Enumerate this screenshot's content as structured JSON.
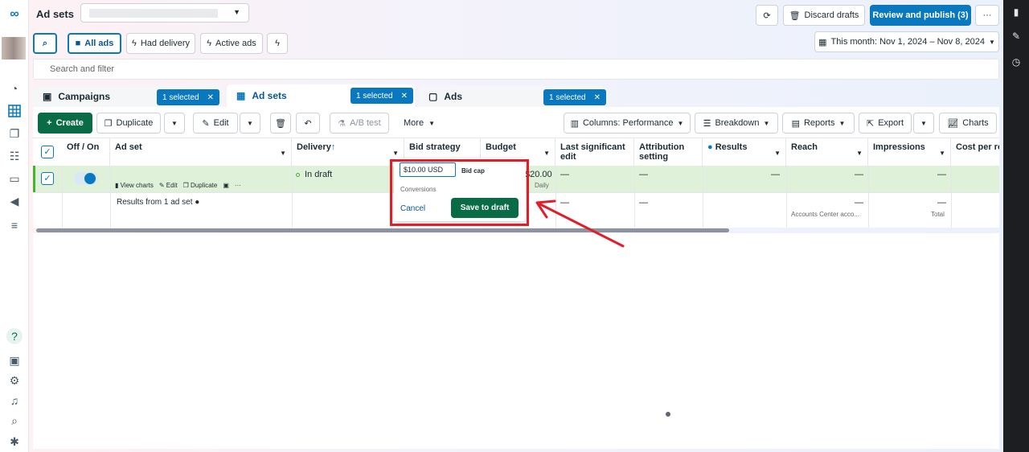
{
  "sidebar_left": {
    "icons": [
      "meta-logo-icon",
      "account-avatar-icon",
      "dashboard-icon",
      "table-icon",
      "pages-icon",
      "audiences-icon",
      "billing-icon",
      "megaphone-icon",
      "menu-icon",
      "help-icon",
      "events-icon",
      "settings-icon",
      "bell-icon",
      "search-icon",
      "bug-icon"
    ]
  },
  "header": {
    "title": "Ad sets",
    "refresh_label": "",
    "discard_label": "Discard drafts",
    "review_label": "Review and publish (3)",
    "more_label": "···"
  },
  "filters": {
    "all_ads": "All ads",
    "had_delivery": "Had delivery",
    "active_ads": "Active ads",
    "date_range": "This month: Nov 1, 2024 – Nov 8, 2024",
    "search_placeholder": "Search and filter"
  },
  "tabs": [
    {
      "label": "Campaigns",
      "chip": "1 selected"
    },
    {
      "label": "Ad sets",
      "chip": "1 selected"
    },
    {
      "label": "Ads",
      "chip": "1 selected"
    }
  ],
  "toolbar": {
    "create": "Create",
    "duplicate": "Duplicate",
    "edit": "Edit",
    "ab_test": "A/B test",
    "more": "More",
    "columns": "Columns: Performance",
    "breakdown": "Breakdown",
    "reports": "Reports",
    "export": "Export",
    "charts": "Charts"
  },
  "table": {
    "headers": {
      "offon": "Off / On",
      "adset": "Ad set",
      "delivery": "Delivery",
      "bid_strategy": "Bid strategy",
      "budget": "Budget",
      "last_edit": "Last significant edit",
      "attribution": "Attribution setting",
      "results": "Results",
      "reach": "Reach",
      "impressions": "Impressions",
      "cost": "Cost per res"
    },
    "row": {
      "delivery": "In draft",
      "budget_value": "$20.00",
      "budget_period": "Daily",
      "view_charts": "View charts",
      "edit": "Edit",
      "duplicate": "Duplicate",
      "dash": "—"
    },
    "summary": {
      "label": "Results from 1 ad set",
      "reach_note": "Accounts Center acco...",
      "impressions_note": "Total",
      "dash": "—"
    }
  },
  "popover": {
    "value": "$10.00 USD",
    "bid_type": "Bid cap",
    "goal": "Conversions",
    "cancel": "Cancel",
    "save": "Save to draft"
  },
  "sidebar_right": {
    "icons": [
      "bar-chart-icon",
      "pencil-icon",
      "clock-icon"
    ]
  },
  "colors": {
    "accent": "#0a78be",
    "save_green": "#0a6b47",
    "highlight_red": "#e11d2a",
    "row_selected": "#dff1d8"
  }
}
